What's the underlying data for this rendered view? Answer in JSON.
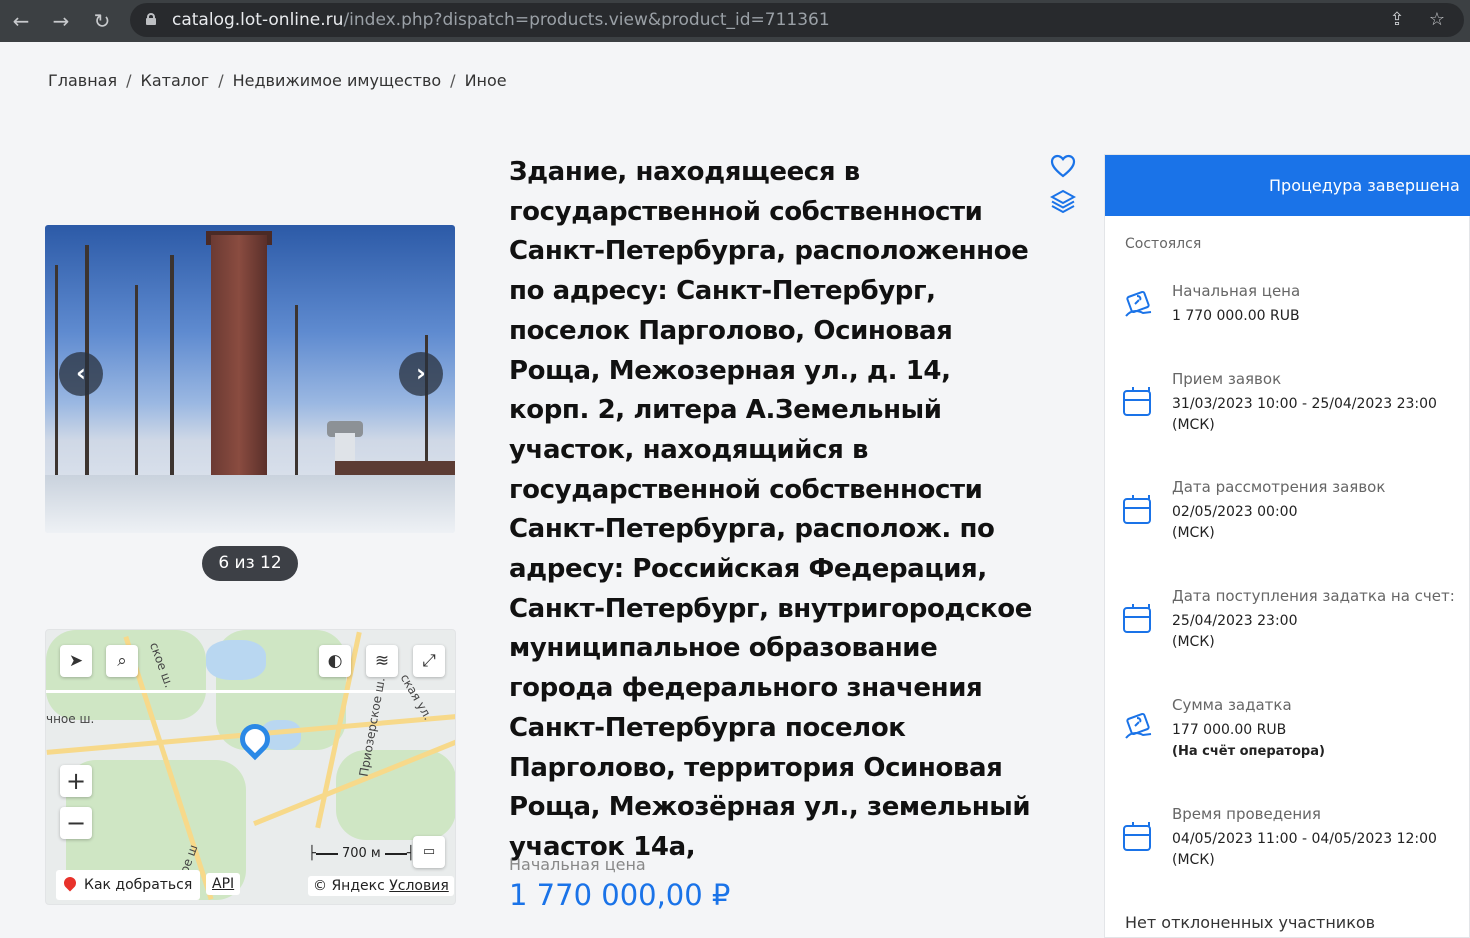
{
  "browser": {
    "url_host": "catalog.lot-online.ru",
    "url_path": "/index.php?dispatch=products.view&product_id=711361"
  },
  "breadcrumb": [
    "Главная",
    "Каталог",
    "Недвижимое имущество",
    "Иное"
  ],
  "gallery": {
    "counter": "6 из 12"
  },
  "map": {
    "route_label": "Как добраться",
    "api_label": "API",
    "copyright": "© Яндекс",
    "terms": "Условия",
    "scale": "700 м",
    "street_labels": [
      "Приозерское ш.",
      "ская ул.",
      "ское ш.",
      "чное ш.",
      "ое ш"
    ]
  },
  "product": {
    "title": "Здание, находящееся в государственной собственности Санкт-Петербурга, расположенное по адресу: Санкт-Петербург, поселок Парголово, Осиновая Роща, Межозерная ул., д. 14, корп. 2, литера А.Земельный участок, находящийся в государственной собственности Санкт-Петербурга, располож. по адресу: Российская Федерация, Санкт-Петербург, внутригородское муниципальное образование города федерального значения Санкт-Петербурга поселок Парголово, территория Осиновая Роща, Межозёрная ул., земельный участок 14а,",
    "price_label": "Начальная цена",
    "price_value": "1 770 000,00 ₽"
  },
  "panel": {
    "header": "Процедура завершена",
    "status": "Состоялся",
    "rows": [
      {
        "label": "Начальная цена",
        "value": "1 770 000.00 RUB",
        "icon": "money-hand-icon"
      },
      {
        "label": "Прием заявок",
        "value": "31/03/2023 10:00  - 25/04/2023 23:00",
        "value2": "(МСК)",
        "icon": "calendar-icon"
      },
      {
        "label": "Дата рассмотрения заявок",
        "value": "02/05/2023 00:00",
        "value2": "(МСК)",
        "icon": "calendar-icon"
      },
      {
        "label": "Дата поступления задатка на счет:",
        "value": "25/04/2023 23:00",
        "value2": "(МСК)",
        "icon": "calendar-icon"
      },
      {
        "label": "Сумма задатка",
        "value": "177 000.00 RUB",
        "value2": "(На счёт оператора)",
        "icon": "money-hand-icon"
      },
      {
        "label": "Время проведения",
        "value": "04/05/2023 11:00 - 04/05/2023 12:00",
        "value2": "(МСК)",
        "icon": "calendar-icon"
      }
    ],
    "bottom": "Нет отклоненных участников"
  },
  "colors": {
    "accent": "#1a73e8",
    "browser": "#3c4043"
  }
}
